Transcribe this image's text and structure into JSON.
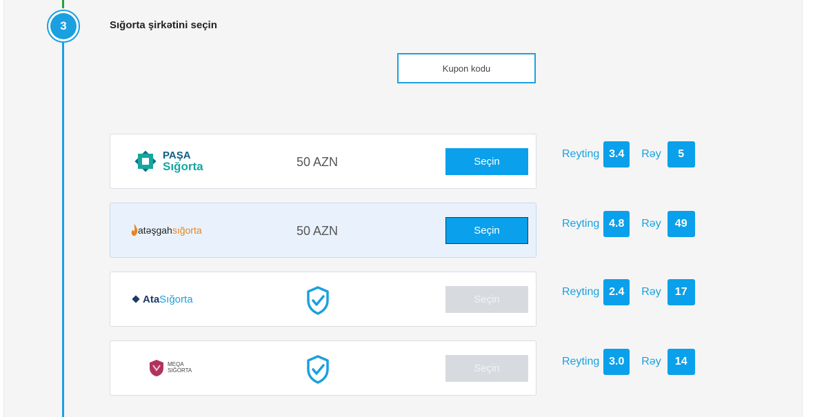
{
  "step": {
    "number": "3",
    "title": "Sığorta şirkətini seçin"
  },
  "coupon": {
    "label": "Kupon kodu"
  },
  "labels": {
    "rating": "Reyting",
    "reviews": "Rəy",
    "select": "Seçin"
  },
  "companies": [
    {
      "logo_line1": "PAŞA",
      "logo_line2": "Sığorta",
      "price": "50 AZN",
      "rating": "3.4",
      "reviews": "5",
      "selectable": true
    },
    {
      "logo_part1": "atəşgah",
      "logo_part2": "sığorta",
      "price": "50 AZN",
      "rating": "4.8",
      "reviews": "49",
      "selectable": true,
      "highlighted": true
    },
    {
      "logo_part1": "Ata",
      "logo_part2": "Sığorta",
      "icon": "shield-check-icon",
      "rating": "2.4",
      "reviews": "17",
      "selectable": false
    },
    {
      "logo_line1": "MEQA",
      "logo_line2": "SIĞORTA",
      "icon": "shield-check-icon",
      "rating": "3.0",
      "reviews": "14",
      "selectable": false
    }
  ],
  "colors": {
    "accent": "#0aa0eb",
    "timeline_top": "#2e9e3e",
    "disabled": "#d7dbe0"
  }
}
